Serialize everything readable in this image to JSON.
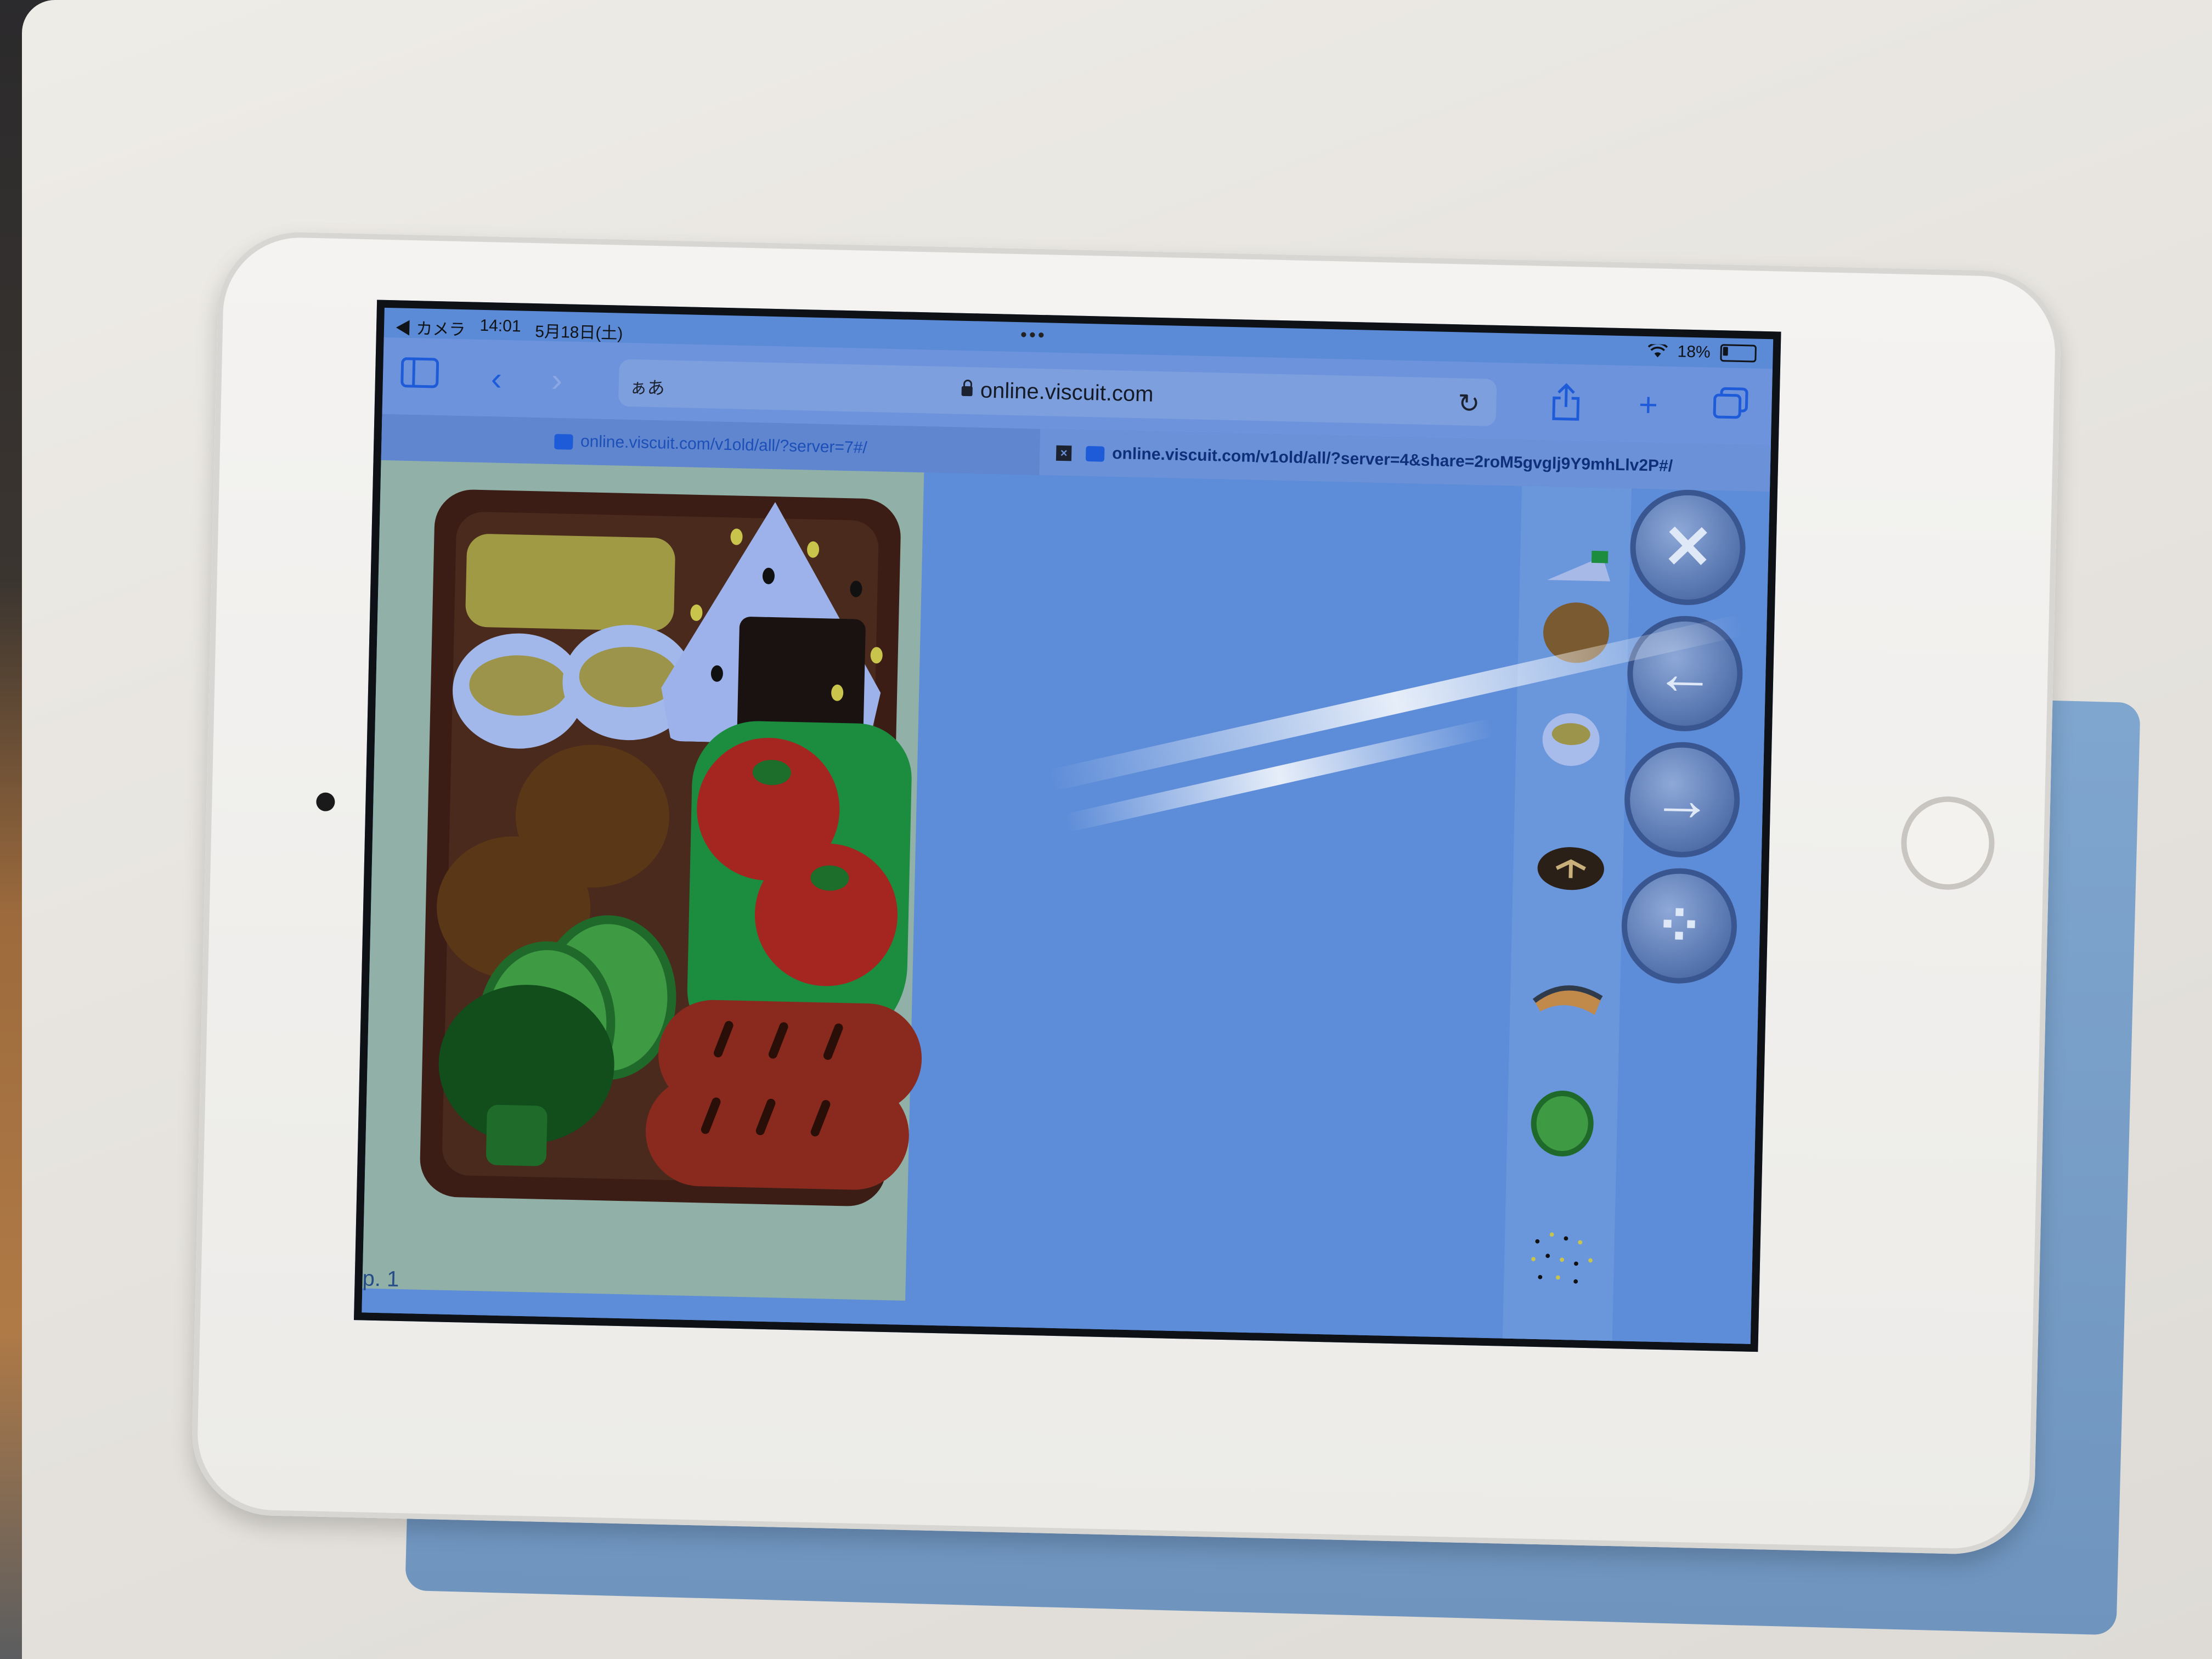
{
  "status_bar": {
    "back_app": "◀ カメラ",
    "time": "14:01",
    "date": "5月18日(土)",
    "battery_pct": "18%",
    "battery_level": 0.18,
    "multitask_dots": "•••"
  },
  "toolbar": {
    "sidebar_icon": "sidebar-icon",
    "back_icon": "‹",
    "forward_icon": "›",
    "reader_label": "ぁあ",
    "url": "online.viscuit.com",
    "reload_icon": "↻",
    "share_icon": "share-icon",
    "new_tab_icon": "+",
    "tabs_icon": "tabs-icon"
  },
  "tabs": [
    {
      "title": "online.viscuit.com/v1old/all/?server=7#/",
      "active": false
    },
    {
      "title": "online.viscuit.com/v1old/all/?server=4&share=2roM5gvglj9Y9mhLlv2P#/",
      "active": true,
      "close_icon": "×"
    }
  ],
  "stage": {
    "page_number": "p. 1"
  },
  "palette": [
    {
      "name": "rice-ball-part-icon"
    },
    {
      "name": "karaage-icon"
    },
    {
      "name": "egg-icon"
    },
    {
      "name": "shiitake-icon"
    },
    {
      "name": "salmon-icon"
    },
    {
      "name": "cucumber-slice-icon"
    },
    {
      "name": "sesame-dots-icon"
    },
    {
      "name": "umeboshi-icon"
    }
  ],
  "controls": [
    {
      "name": "delete-button",
      "icon": "✕"
    },
    {
      "name": "back-arrow-button",
      "icon": "←"
    },
    {
      "name": "forward-arrow-button",
      "icon": "→"
    },
    {
      "name": "settings-dots-button",
      "icon": "⁘"
    }
  ],
  "colors": {
    "safari_accent": "#1e5bd8",
    "canvas_bg": "#5d8cd8",
    "page_bg": "#91b0a8",
    "bento_box": "#3b1d16"
  }
}
